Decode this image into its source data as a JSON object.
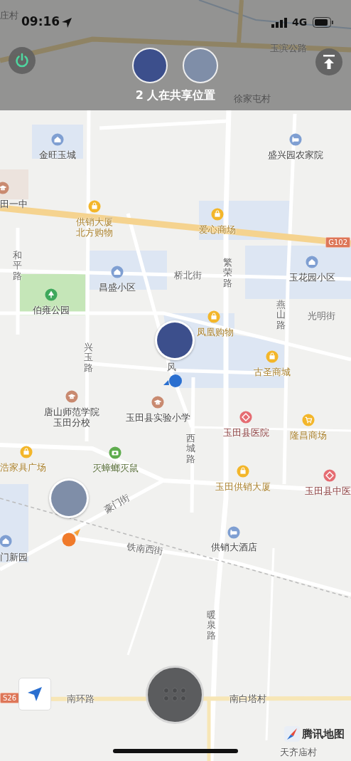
{
  "status_bar": {
    "time": "09:16",
    "network": "4G"
  },
  "sharing": {
    "caption": "2 人在共享位置"
  },
  "map": {
    "labels": [
      {
        "text": "庄村",
        "kind": "place"
      },
      {
        "text": "玉滨公路",
        "kind": "road"
      },
      {
        "text": "徐家屯村",
        "kind": "place"
      },
      {
        "text": "金旺玉城",
        "kind": "residential"
      },
      {
        "text": "盛兴园农家院",
        "kind": "hotel"
      },
      {
        "text": "田一中",
        "kind": "school"
      },
      {
        "text": "供销大厦北方购物",
        "kind": "mall"
      },
      {
        "text": "爱心商场",
        "kind": "mall"
      },
      {
        "text": "和平路",
        "kind": "road"
      },
      {
        "text": "桥北街",
        "kind": "road"
      },
      {
        "text": "繁荣路",
        "kind": "road"
      },
      {
        "text": "昌盛小区",
        "kind": "residential"
      },
      {
        "text": "玉花园小区",
        "kind": "residential"
      },
      {
        "text": "伯雍公园",
        "kind": "park"
      },
      {
        "text": "燕山路",
        "kind": "road"
      },
      {
        "text": "光明街",
        "kind": "road"
      },
      {
        "text": "凤凰购物",
        "kind": "mall"
      },
      {
        "text": "古圣商城",
        "kind": "mall"
      },
      {
        "text": "兴玉路",
        "kind": "road"
      },
      {
        "text": "风",
        "kind": "road"
      },
      {
        "text": "唐山师范学院玉田分校",
        "kind": "school"
      },
      {
        "text": "玉田县实验小学",
        "kind": "school"
      },
      {
        "text": "西城路",
        "kind": "road"
      },
      {
        "text": "玉田县医院",
        "kind": "hospital"
      },
      {
        "text": "隆昌商场",
        "kind": "market"
      },
      {
        "text": "浩家具广场",
        "kind": "mall"
      },
      {
        "text": "灭蟑螂灭鼠",
        "kind": "service"
      },
      {
        "text": "玉田供销大厦",
        "kind": "mall"
      },
      {
        "text": "玉田县中医",
        "kind": "hospital"
      },
      {
        "text": "豪门街",
        "kind": "road"
      },
      {
        "text": "门新园",
        "kind": "residential"
      },
      {
        "text": "铁南西街",
        "kind": "road"
      },
      {
        "text": "供销大酒店",
        "kind": "hotel"
      },
      {
        "text": "暖泉路",
        "kind": "road"
      },
      {
        "text": "南环路",
        "kind": "road"
      },
      {
        "text": "南白塔村",
        "kind": "place"
      },
      {
        "text": "天齐庙村",
        "kind": "place"
      }
    ],
    "route_badges": [
      "G102",
      "S26"
    ]
  },
  "logo": {
    "text": "腾讯地图"
  }
}
